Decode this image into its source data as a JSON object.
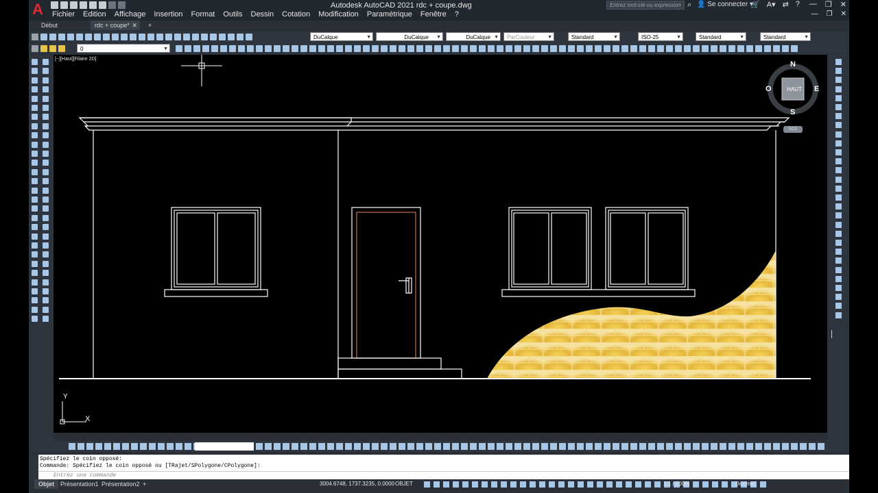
{
  "app": {
    "logo": "A",
    "window_title": "Autodesk AutoCAD 2021    rdc + coupe.dwg",
    "search_placeholder": "Entrez mot-clé ou expression",
    "signin": "Se connecter",
    "help": "?"
  },
  "menu": [
    "Fichier",
    "Edition",
    "Affichage",
    "Insertion",
    "Format",
    "Outils",
    "Dessin",
    "Cotation",
    "Modification",
    "Paramétrique",
    "Fenêtre",
    "?"
  ],
  "file_tabs": [
    {
      "label": "Début"
    },
    {
      "label": "rdc + coupe*",
      "close": "✕"
    },
    {
      "label": "+"
    }
  ],
  "properties": {
    "color": "DuCalque",
    "linetype": "DuCalque",
    "lineweight": "DuCalque",
    "plotstyle": "ParCouleur",
    "text_style": "Standard",
    "dim_style": "ISO-25",
    "table_style": "Standard",
    "mleader_style": "Standard",
    "layer": "0"
  },
  "viewport": {
    "label": "[−][Haut][Filaire 2D]",
    "viewcube": {
      "face": "HAUT",
      "n": "N",
      "s": "S",
      "e": "E",
      "w": "O"
    },
    "wcs": "SCG",
    "ucs_x": "X",
    "ucs_y": "Y"
  },
  "command": {
    "history": [
      "Spécifiez le coin opposé:",
      "Commande: Spécifiez le coin opposé ou [TRajet/SPolygone/CPolygone]:"
    ],
    "prompt_placeholder": "Entrez une commande"
  },
  "status": {
    "layout_tabs": [
      {
        "label": "Objet",
        "active": true
      },
      {
        "label": "Présentation1",
        "active": false
      },
      {
        "label": "Présentation2",
        "active": false
      },
      {
        "label": "+",
        "active": false
      }
    ],
    "coordinates": "3004.6748, 1737.3235, 0.0000",
    "space": "OBJET",
    "annotation_scale": "1:1 / 100%",
    "units": "Décimal"
  },
  "colors": {
    "accent_red": "#e0292b",
    "canvas": "#000000",
    "drawing_lines": "#ffffff",
    "door_frame": "#c0704a",
    "brick_fill": "#d8a830"
  }
}
